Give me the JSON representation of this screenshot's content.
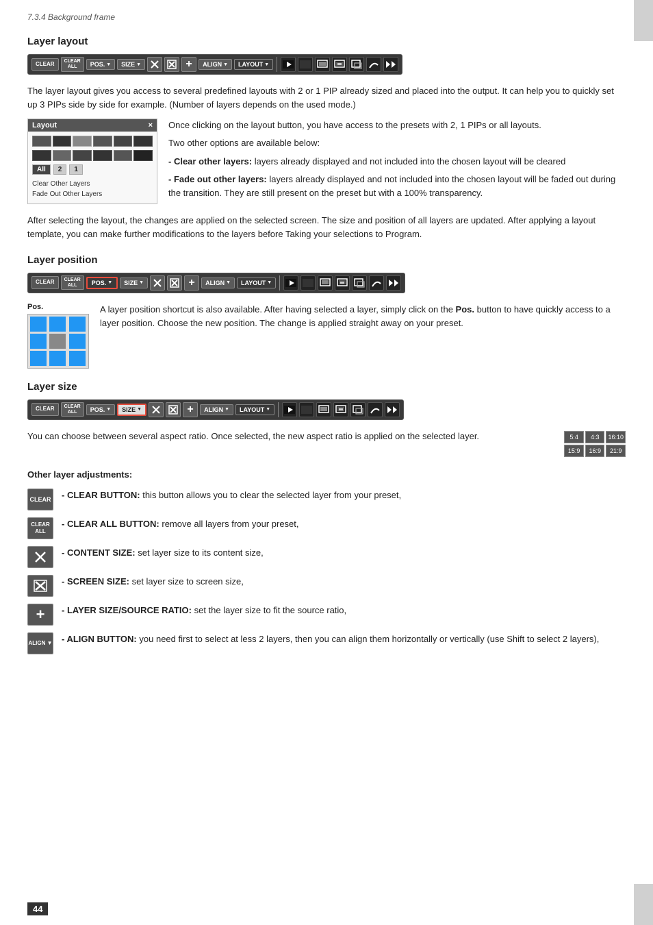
{
  "page": {
    "header": "7.3.4 Background frame",
    "page_number": "44"
  },
  "sections": {
    "layer_layout": {
      "title": "Layer layout",
      "description": "The layer layout gives you access to several predefined layouts with 2 or 1 PIP already sized and placed into the output. It can help you to quickly set up 3 PIPs side by side for example. (Number of layers depends on the used mode.)",
      "layout_panel": {
        "title": "Layout",
        "close_icon": "×",
        "tabs": [
          "All",
          "2",
          "1"
        ],
        "options": [
          "Clear Other Layers",
          "Fade Out Other Layers"
        ]
      },
      "content_intro": "Once clicking on the layout button, you have access to the presets with 2, 1 PIPs or all layouts.",
      "content_options": "Two other options are available below:",
      "clear_option": "- Clear other layers: layers already displayed and not included into the chosen layout will be cleared",
      "fade_option": "- Fade out other layers: layers already displayed and not included into the chosen layout will be faded out during the transition. They are still present on the preset but with a 100% transparency.",
      "after_text": "After selecting the layout, the changes are applied on the selected screen. The size and position of all layers are updated. After applying a layout template, you can make further modifications to the layers before Taking your selections to Program."
    },
    "layer_position": {
      "title": "Layer position",
      "pos_label": "Pos.",
      "description": "A layer position shortcut is also available. After having selected a layer, simply click on the Pos. button to have quickly access to a layer position. Choose the new position. The change is applied straight away on your preset."
    },
    "layer_size": {
      "title": "Layer size",
      "description": "You can choose between several aspect ratio. Once selected, the new aspect ratio is applied on the selected layer.",
      "ratios": [
        [
          "5:4",
          "4:3",
          "16:10"
        ],
        [
          "15:9",
          "16:9",
          "21:9"
        ]
      ]
    },
    "other_adjustments": {
      "title": "Other layer adjustments:",
      "items": [
        {
          "icon_type": "clear",
          "icon_label": "CLEAR",
          "text_bold": "- CLEAR BUTTON:",
          "text_rest": " this button allows you to clear the selected layer from your preset,"
        },
        {
          "icon_type": "clear_all",
          "icon_label": "CLEAR\nALL",
          "text_bold": "- CLEAR ALL BUTTON:",
          "text_rest": " remove all layers from your preset,"
        },
        {
          "icon_type": "content_size",
          "icon_label": "✕",
          "text_bold": "- CONTENT SIZE:",
          "text_rest": " set layer size to its content size,"
        },
        {
          "icon_type": "screen_size",
          "icon_label": "✕",
          "text_bold": "- SCREEN SIZE:",
          "text_rest": " set layer size to screen size,"
        },
        {
          "icon_type": "layer_ratio",
          "icon_label": "+",
          "text_bold": "- LAYER SIZE/SOURCE RATIO:",
          "text_rest": " set the layer size to fit the source ratio,"
        },
        {
          "icon_type": "align",
          "icon_label": "ALIGN ▼",
          "text_bold": "- ALIGN BUTTON:",
          "text_rest": " you need first to select at less 2 layers, then you can align them horizontally or vertically (use Shift to select 2 layers),"
        }
      ]
    }
  },
  "toolbar": {
    "clear_label": "CLEAR",
    "clear_all_label": "CLEAR\nALL",
    "pos_label": "POS.",
    "size_label": "SIZE",
    "align_label": "ALIGN",
    "layout_label": "LAYOUT"
  }
}
